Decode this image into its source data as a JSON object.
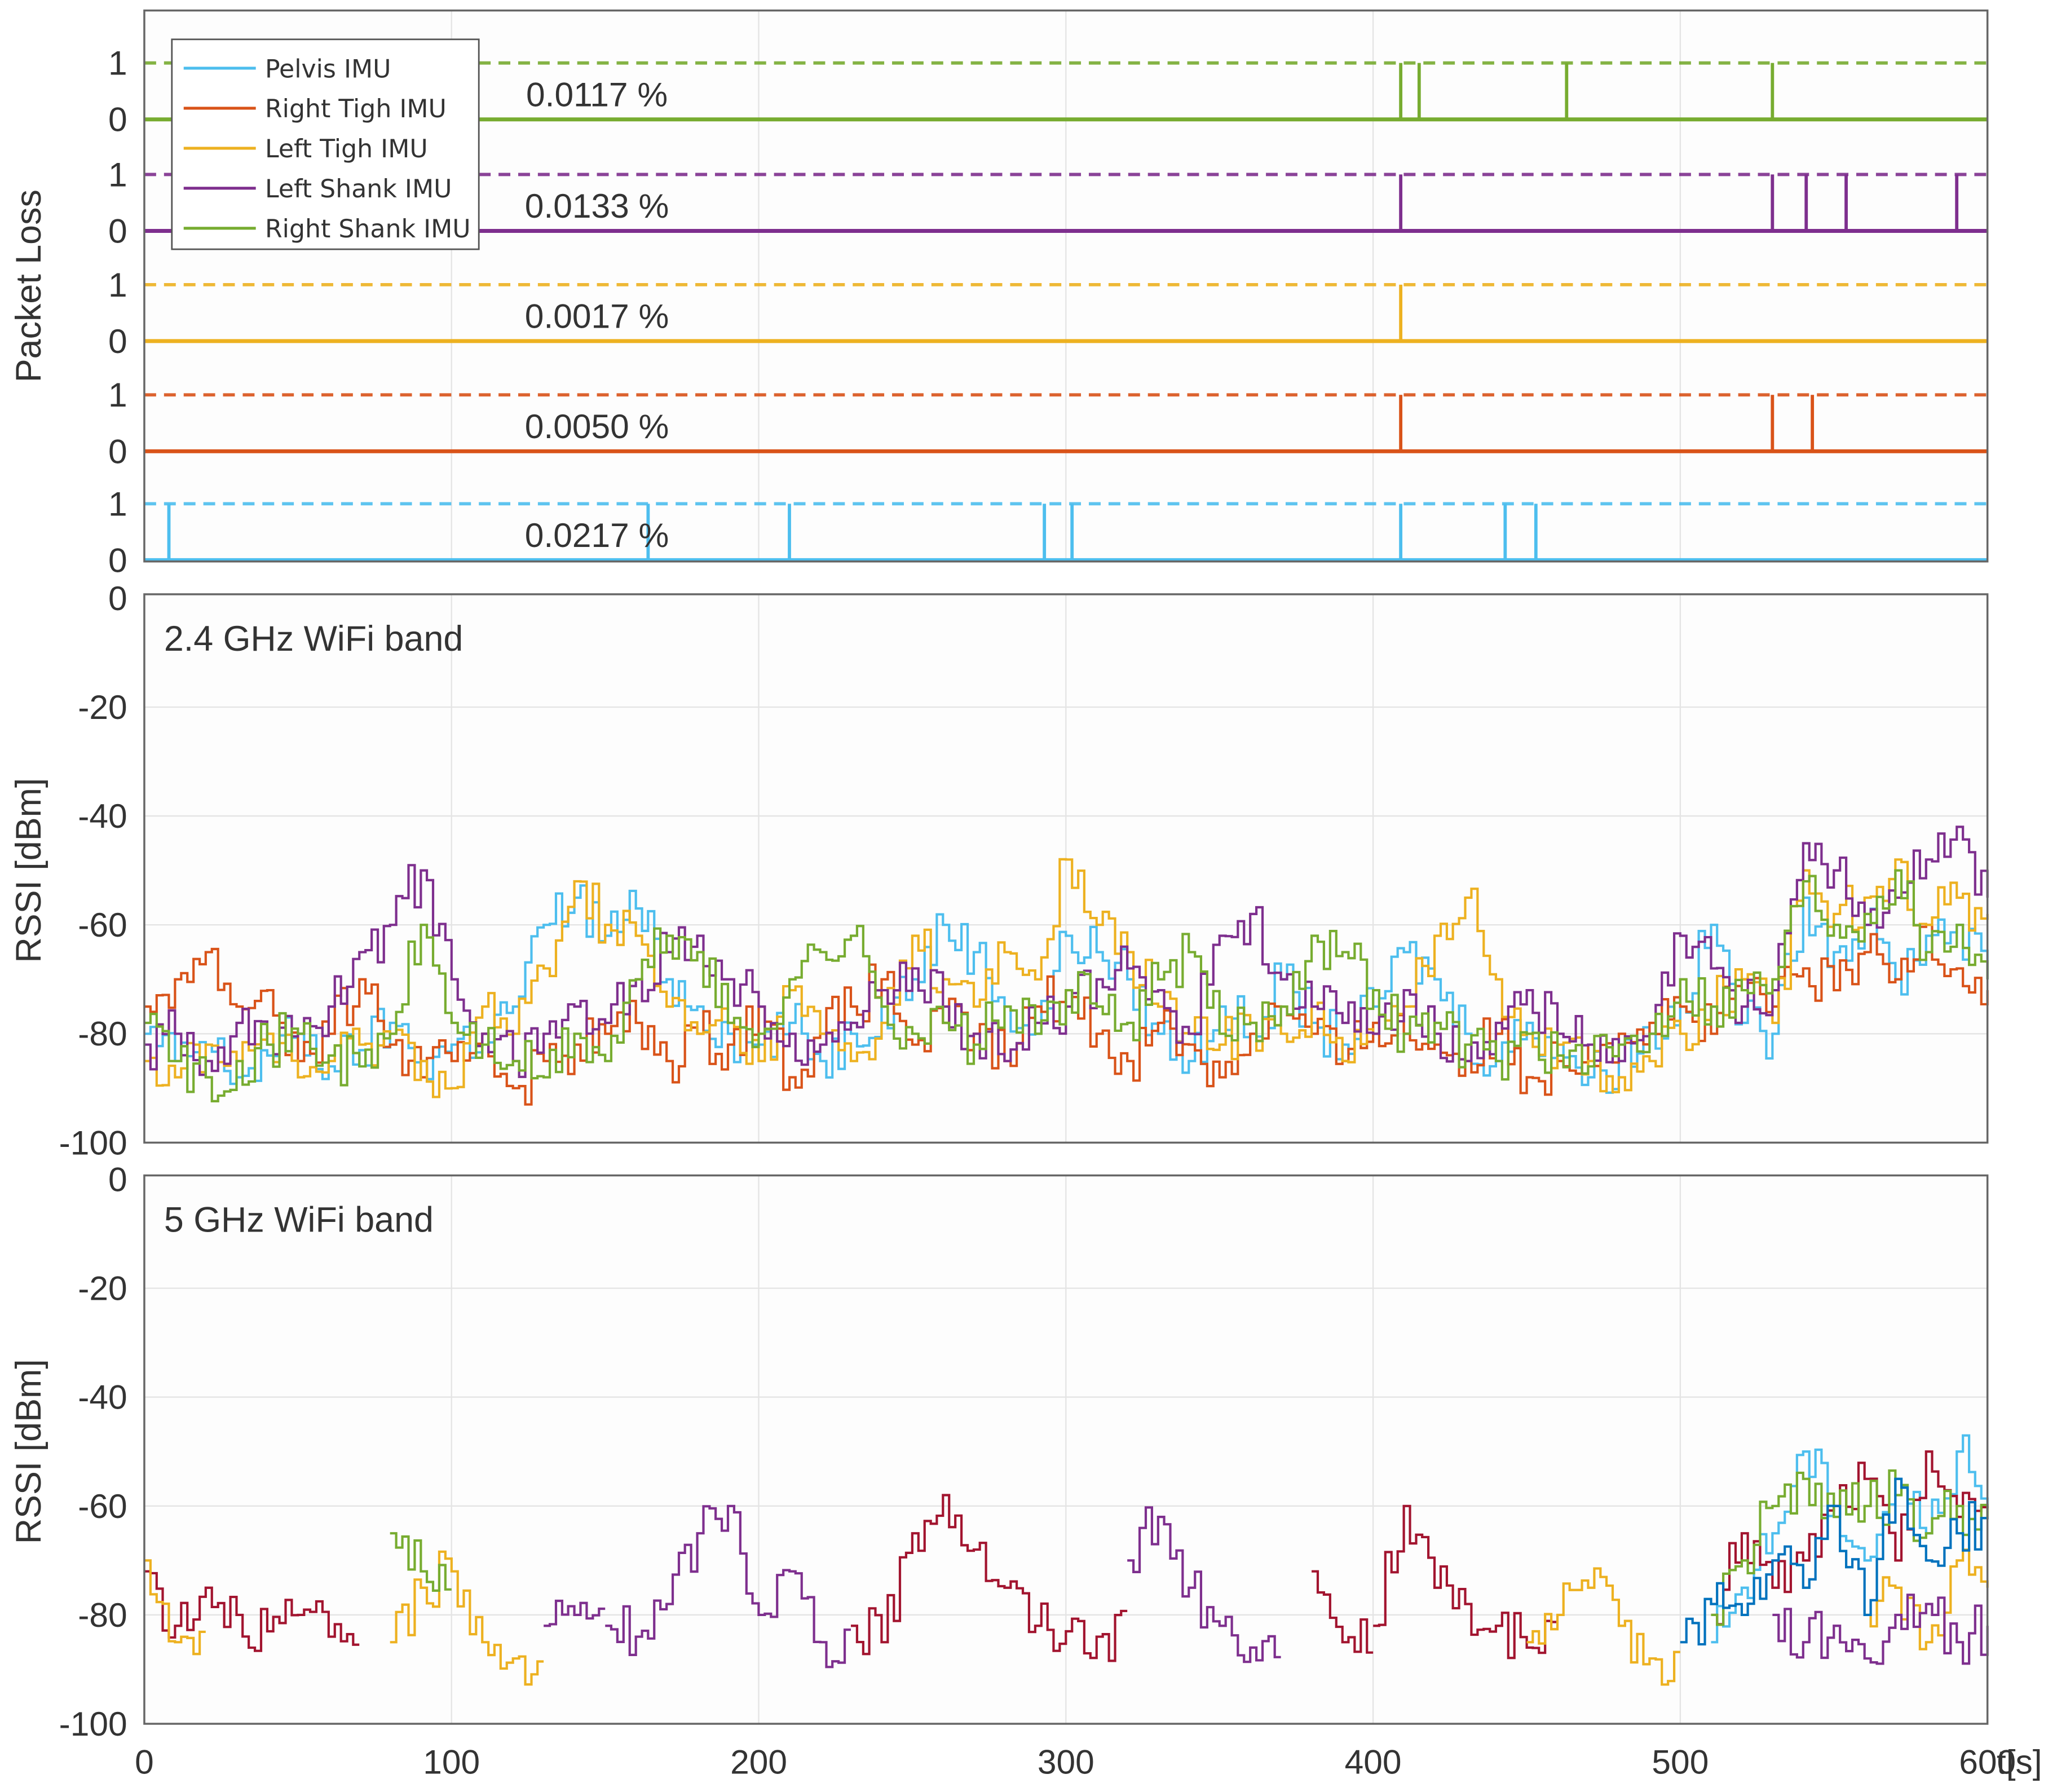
{
  "chart_data": [
    {
      "type": "line",
      "title": "",
      "ylabel": "Packet Loss",
      "xlabel": "t[s]",
      "xlim": [
        0,
        600
      ],
      "xticks": [
        "0",
        "100",
        "200",
        "300",
        "400",
        "500",
        "600"
      ],
      "ytick_labels": [
        "0",
        "1"
      ],
      "grid": true,
      "legend_placement": "top-left",
      "series": [
        {
          "name": "Pelvis IMU",
          "color": "#4DBEEE",
          "loss_label": "0.0217 %",
          "loss_events_s": [
            8,
            164,
            210,
            293,
            302,
            409,
            443,
            453
          ]
        },
        {
          "name": "Right Tigh IMU",
          "color": "#D95319",
          "loss_label": "0.0050 %",
          "loss_events_s": [
            409,
            530,
            543
          ]
        },
        {
          "name": "Left Tigh IMU",
          "color": "#EDB120",
          "loss_label": "0.0017 %",
          "loss_events_s": [
            409
          ]
        },
        {
          "name": "Left Shank IMU",
          "color": "#7E2F8E",
          "loss_label": "0.0133 %",
          "loss_events_s": [
            409,
            530,
            541,
            554,
            590
          ]
        },
        {
          "name": "Right Shank IMU",
          "color": "#77AC30",
          "loss_label": "0.0117 %",
          "loss_events_s": [
            409,
            415,
            463,
            530
          ]
        }
      ]
    },
    {
      "type": "line",
      "title": "2.4 GHz WiFi band",
      "ylabel": "RSSI [dBm]",
      "xlim": [
        0,
        600
      ],
      "ylim": [
        -100,
        0
      ],
      "yticks": [
        "0",
        "-20",
        "-40",
        "-60",
        "-80",
        "-100"
      ],
      "grid": true,
      "series": [
        {
          "name": "Pelvis IMU",
          "color": "#4DBEEE",
          "segments": [
            {
              "t0": 0,
              "dt": 10,
              "values": [
                -80,
                -85,
                -82,
                -88,
                -84,
                -80,
                -86,
                -83,
                -78,
                -85,
                -82,
                -80,
                -75,
                -60,
                -55,
                -62,
                -57,
                -70,
                -75,
                -80,
                -82,
                -78,
                -85,
                -80,
                -75,
                -70,
                -60,
                -65,
                -75,
                -80,
                -62,
                -65,
                -70,
                -80,
                -85,
                -75,
                -80,
                -70,
                -78,
                -82,
                -75,
                -65,
                -70,
                -80,
                -85,
                -78,
                -82,
                -88,
                -85,
                -80,
                -75,
                -60,
                -78,
                -80,
                -55,
                -65,
                -60,
                -70,
                -62,
                -60,
                -70
              ]
            }
          ]
        },
        {
          "name": "Right Tigh IMU",
          "color": "#D95319",
          "segments": [
            {
              "t0": 0,
              "dt": 10,
              "values": [
                -75,
                -70,
                -65,
                -75,
                -72,
                -85,
                -80,
                -70,
                -82,
                -88,
                -85,
                -80,
                -90,
                -85,
                -82,
                -80,
                -78,
                -85,
                -80,
                -82,
                -75,
                -88,
                -80,
                -75,
                -70,
                -82,
                -78,
                -80,
                -85,
                -75,
                -72,
                -80,
                -85,
                -78,
                -82,
                -88,
                -80,
                -75,
                -80,
                -85,
                -78,
                -80,
                -82,
                -85,
                -80,
                -88,
                -85,
                -82,
                -80,
                -78,
                -75,
                -80,
                -70,
                -75,
                -68,
                -72,
                -65,
                -70,
                -60,
                -68,
                -72
              ]
            }
          ]
        },
        {
          "name": "Left Tigh IMU",
          "color": "#EDB120",
          "segments": [
            {
              "t0": 0,
              "dt": 10,
              "values": [
                -85,
                -88,
                -82,
                -85,
                -80,
                -88,
                -85,
                -82,
                -80,
                -85,
                -90,
                -75,
                -80,
                -68,
                -52,
                -60,
                -62,
                -75,
                -80,
                -78,
                -85,
                -72,
                -80,
                -85,
                -78,
                -62,
                -70,
                -75,
                -65,
                -70,
                -48,
                -60,
                -65,
                -75,
                -80,
                -82,
                -78,
                -80,
                -75,
                -85,
                -80,
                -75,
                -62,
                -55,
                -70,
                -80,
                -82,
                -85,
                -88,
                -85,
                -80,
                -75,
                -70,
                -78,
                -50,
                -58,
                -55,
                -48,
                -60,
                -55,
                -58
              ]
            }
          ]
        },
        {
          "name": "Left Shank IMU",
          "color": "#7E2F8E",
          "segments": [
            {
              "t0": 0,
              "dt": 10,
              "values": [
                -82,
                -80,
                -85,
                -78,
                -82,
                -80,
                -75,
                -65,
                -60,
                -50,
                -70,
                -80,
                -85,
                -80,
                -75,
                -78,
                -70,
                -65,
                -62,
                -70,
                -75,
                -80,
                -82,
                -78,
                -72,
                -68,
                -75,
                -80,
                -85,
                -78,
                -75,
                -70,
                -68,
                -72,
                -80,
                -62,
                -58,
                -70,
                -75,
                -78,
                -80,
                -72,
                -80,
                -85,
                -78,
                -72,
                -80,
                -82,
                -85,
                -80,
                -62,
                -68,
                -75,
                -72,
                -45,
                -50,
                -60,
                -55,
                -48,
                -42,
                -55
              ]
            }
          ]
        },
        {
          "name": "Right Shank IMU",
          "color": "#77AC30",
          "segments": [
            {
              "t0": 0,
              "dt": 10,
              "values": [
                -78,
                -85,
                -88,
                -85,
                -82,
                -80,
                -84,
                -86,
                -80,
                -60,
                -78,
                -82,
                -85,
                -88,
                -80,
                -85,
                -70,
                -62,
                -65,
                -78,
                -80,
                -70,
                -65,
                -62,
                -75,
                -80,
                -78,
                -82,
                -75,
                -80,
                -72,
                -75,
                -78,
                -70,
                -65,
                -80,
                -78,
                -75,
                -62,
                -65,
                -72,
                -80,
                -78,
                -82,
                -85,
                -80,
                -84,
                -86,
                -82,
                -80,
                -70,
                -75,
                -72,
                -70,
                -52,
                -60,
                -58,
                -50,
                -65,
                -60,
                -70
              ]
            }
          ]
        }
      ]
    },
    {
      "type": "line",
      "title": "5 GHz WiFi band",
      "ylabel": "RSSI [dBm]",
      "xlabel": "t[s]",
      "xlim": [
        0,
        600
      ],
      "ylim": [
        -100,
        0
      ],
      "yticks": [
        "0",
        "-20",
        "-40",
        "-60",
        "-80",
        "-100"
      ],
      "xticks": [
        "0",
        "100",
        "200",
        "300",
        "400",
        "500",
        "600"
      ],
      "grid": true,
      "series": [
        {
          "name": "Pelvis IMU",
          "color": "#4DBEEE",
          "segments": [
            {
              "t0": 510,
              "dt": 10,
              "values": [
                -85,
                -75,
                -65,
                -50,
                -60,
                -70,
                -55,
                -65,
                -50,
                -60
              ]
            }
          ]
        },
        {
          "name": "Right Tigh IMU",
          "color": "#A2142F",
          "segments": [
            {
              "t0": 0,
              "dt": 10,
              "values": [
                -72,
                -82,
                -75,
                -80,
                -83,
                -80,
                -84
              ]
            },
            {
              "t0": 230,
              "dt": 10,
              "values": [
                -82,
                -85,
                -65,
                -58,
                -68,
                -75,
                -82,
                -83,
                -84
              ]
            },
            {
              "t0": 380,
              "dt": 10,
              "values": [
                -72,
                -85
              ]
            },
            {
              "t0": 400,
              "dt": 10,
              "values": [
                -82,
                -60,
                -75,
                -78,
                -82,
                -86
              ]
            },
            {
              "t0": 510,
              "dt": 10,
              "values": [
                -80,
                -65,
                -75,
                -70,
                -60,
                -55,
                -70,
                -50,
                -62,
                -60
              ]
            }
          ]
        },
        {
          "name": "Left Tigh IMU",
          "color": "#EDB120",
          "segments": [
            {
              "t0": 0,
              "dt": 10,
              "values": [
                -70,
                -85
              ]
            },
            {
              "t0": 80,
              "dt": 10,
              "values": [
                -85,
                -75,
                -72,
                -85,
                -88
              ]
            },
            {
              "t0": 450,
              "dt": 10,
              "values": [
                -85,
                -80,
                -75,
                -82,
                -88
              ]
            },
            {
              "t0": 560,
              "dt": 10,
              "values": [
                -80,
                -75,
                -85,
                -70,
                -75
              ]
            }
          ]
        },
        {
          "name": "Left Shank IMU",
          "color": "#7E2F8E",
          "segments": [
            {
              "t0": 130,
              "dt": 10,
              "values": [
                -82,
                -80
              ]
            },
            {
              "t0": 150,
              "dt": 10,
              "values": [
                -82,
                -84,
                -78,
                -65,
                -60,
                -80,
                -72,
                -85
              ]
            },
            {
              "t0": 320,
              "dt": 10,
              "values": [
                -70,
                -62,
                -75,
                -82,
                -86
              ]
            },
            {
              "t0": 530,
              "dt": 10,
              "values": [
                -80,
                -85,
                -82,
                -88,
                -80,
                -78,
                -85,
                -82
              ]
            }
          ]
        },
        {
          "name": "Right Shank IMU",
          "color": "#77AC30",
          "segments": [
            {
              "t0": 80,
              "dt": 10,
              "values": [
                -65,
                -72
              ]
            },
            {
              "t0": 510,
              "dt": 10,
              "values": [
                -80,
                -70,
                -60,
                -55,
                -62,
                -60,
                -58,
                -65,
                -60,
                -62
              ]
            }
          ]
        },
        {
          "name": "",
          "color": "#0072BD",
          "segments": [
            {
              "t0": 500,
              "dt": 10,
              "values": [
                -85,
                -78,
                -80,
                -70,
                -75,
                -60,
                -80,
                -55,
                -70,
                -65,
                -62
              ]
            }
          ]
        }
      ]
    }
  ]
}
